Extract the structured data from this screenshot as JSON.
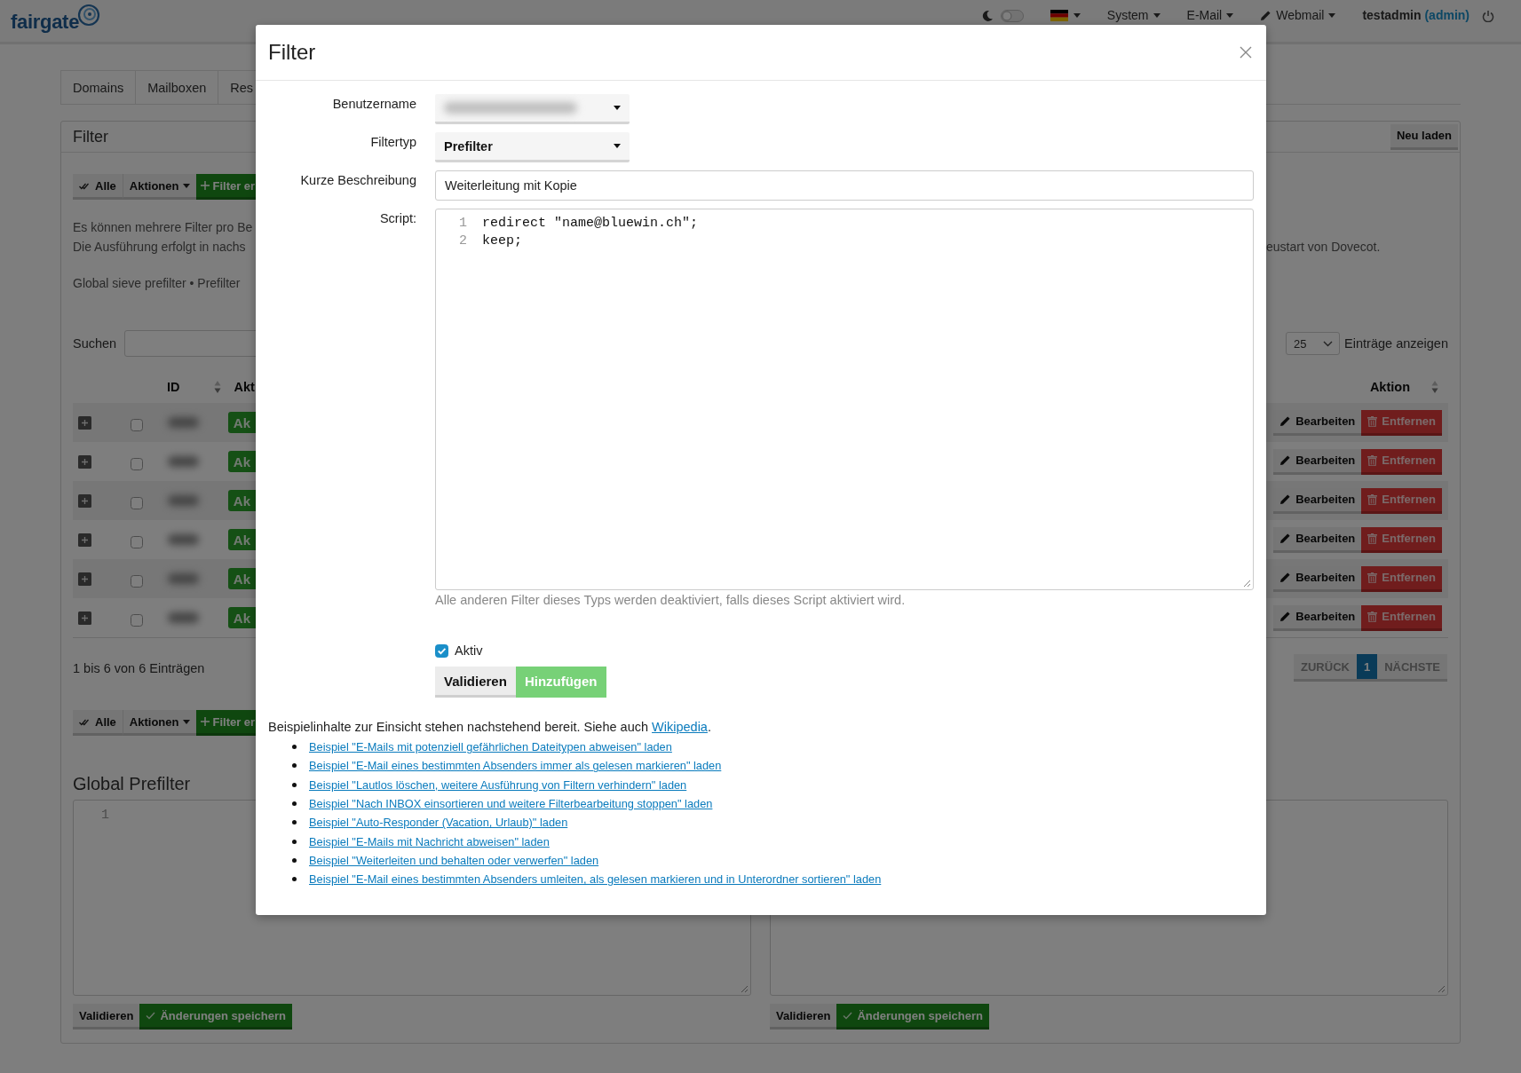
{
  "navbar": {
    "logo": "fairgate",
    "dark_mode": false,
    "menus": [
      {
        "label": "System",
        "has_icon": false
      },
      {
        "label": "E-Mail",
        "has_icon": false
      },
      {
        "label": "Webmail",
        "has_icon": true
      }
    ],
    "user": "testadmin",
    "role": "(admin)"
  },
  "tabs": [
    {
      "label": "Domains",
      "selected": false
    },
    {
      "label": "Mailboxen",
      "selected": false
    },
    {
      "label": "Res",
      "selected": false
    }
  ],
  "panel": {
    "title": "Filter",
    "reload": "Neu laden",
    "toolbar": {
      "select_all": "Alle",
      "actions": "Aktionen",
      "add": "Filter er"
    },
    "info": [
      "Es können mehrere Filter pro Be",
      "Die Ausführung erfolgt in nachs"
    ],
    "info_end": "eustart von Dovecot.",
    "types": "Global sieve prefilter • Prefilter",
    "search_label": "Suchen",
    "page_size": "25",
    "page_size_label": "Einträge anzeigen",
    "columns": [
      "ID",
      "Akt",
      "Aktion"
    ],
    "rows": [
      {
        "expanded": false,
        "checked": false,
        "status": "Ak",
        "edit": "Bearbeiten",
        "remove": "Entfernen"
      },
      {
        "expanded": false,
        "checked": false,
        "status": "Ak",
        "edit": "Bearbeiten",
        "remove": "Entfernen"
      },
      {
        "expanded": false,
        "checked": false,
        "status": "Ak",
        "edit": "Bearbeiten",
        "remove": "Entfernen"
      },
      {
        "expanded": false,
        "checked": false,
        "status": "Ak",
        "edit": "Bearbeiten",
        "remove": "Entfernen"
      },
      {
        "expanded": false,
        "checked": false,
        "status": "Ak",
        "edit": "Bearbeiten",
        "remove": "Entfernen"
      },
      {
        "expanded": false,
        "checked": false,
        "status": "Ak",
        "edit": "Bearbeiten",
        "remove": "Entfernen"
      }
    ],
    "summary": "1 bis 6 von 6 Einträgen",
    "pagination": {
      "previous": "ZURÜCK",
      "pages": [
        {
          "label": "1",
          "selected": true
        }
      ],
      "next": "NÄCHSTE"
    },
    "bottom_toolbar": {
      "select_all": "Alle",
      "actions": "Aktionen",
      "add": "Filter er"
    }
  },
  "global_prefilter": {
    "title": "Global Prefilter",
    "editors": [
      {
        "line_numbers": [
          "1"
        ],
        "validate": "Validieren",
        "save": "Änderungen speichern"
      },
      {
        "validate": "Validieren",
        "save": "Änderungen speichern"
      }
    ]
  },
  "dialog": {
    "title": "Filter",
    "fields": [
      {
        "kind": "select",
        "label": "Benutzername",
        "blurred": true
      },
      {
        "kind": "select",
        "label": "Filtertyp",
        "value": "Prefilter",
        "blurred": false
      },
      {
        "kind": "text",
        "label": "Kurze Beschreibung",
        "value": "Weiterleitung mit Kopie"
      },
      {
        "kind": "code",
        "label": "Script:",
        "lines": [
          {
            "number": "1",
            "code": "redirect \"name@bluewin.ch\";"
          },
          {
            "number": "2",
            "code": "keep;"
          }
        ],
        "help": "Alle anderen Filter dieses Typs werden deaktiviert, falls dieses Script aktiviert wird."
      }
    ],
    "active": {
      "label": "Aktiv",
      "checked": true
    },
    "buttons": [
      {
        "label": "Validieren",
        "kind": "default",
        "disabled": false
      },
      {
        "label": "Hinzufügen",
        "kind": "success",
        "disabled": true
      }
    ],
    "examples": {
      "intro": "Beispielinhalte zur Einsicht stehen nachstehend bereit. Siehe auch ",
      "link": "Wikipedia",
      "end": ".",
      "items": [
        "Beispiel \"E-Mails mit potenziell gefährlichen Dateitypen abweisen\" laden",
        "Beispiel \"E-Mail eines bestimmten Absenders immer als gelesen markieren\" laden",
        "Beispiel \"Lautlos löschen, weitere Ausführung von Filtern verhindern\" laden",
        "Beispiel \"Nach INBOX einsortieren und weitere Filterbearbeitung stoppen\" laden",
        "Beispiel \"Auto-Responder (Vacation, Urlaub)\" laden",
        "Beispiel \"E-Mails mit Nachricht abweisen\" laden",
        "Beispiel \"Weiterleiten und behalten oder verwerfen\" laden",
        "Beispiel \"E-Mail eines bestimmten Absenders umleiten, als gelesen markieren und in Unterordner sortieren\" laden"
      ]
    }
  }
}
